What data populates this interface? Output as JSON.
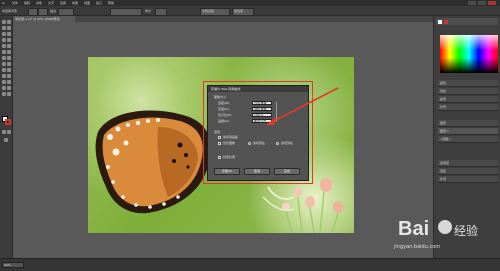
{
  "menubar": {
    "items": [
      "Ai",
      "文件",
      "编辑",
      "对象",
      "文字",
      "选择",
      "效果",
      "视图",
      "窗口",
      "帮助"
    ]
  },
  "optionbar": {
    "selection_label": "未选择对象",
    "stroke_label": "描边",
    "style_label": "样式",
    "doc_setup_label": "文档设置",
    "prefs_label": "首选项"
  },
  "document": {
    "tab_label": "未标题-1.ai* @ 50% (RGB/预览)"
  },
  "dialog": {
    "title": "存储为 Web 所用格式",
    "section_size": "图像大小",
    "rows": [
      {
        "label": "宽度(W):",
        "value": "720 像素"
      },
      {
        "label": "高度(H):",
        "value": "480 像素"
      },
      {
        "label": "百分比(P):",
        "value": "100 %"
      },
      {
        "label": "品质(Q):",
        "value": "两次立方"
      }
    ],
    "section_options": "选项",
    "checkbox_1": "剪切到画板",
    "checkbox_2": "优化图像",
    "radio_a": "剪切到左",
    "radio_b": "剪切到右",
    "checkbox_3": "约束比例",
    "buttons": [
      "存储(S)",
      "取消",
      "完成"
    ]
  },
  "right_panel": {
    "rows": [
      "颜色",
      "色板",
      "画笔",
      "符号",
      "图层",
      "图层 1",
      "<图像>",
      "透明度",
      "渐变",
      "外观"
    ]
  },
  "status": {
    "zoom": "50%"
  },
  "watermark": {
    "text": "Bai",
    "brand": "经验",
    "url": "jingyan.baidu.com"
  },
  "colors": {
    "highlight": "#e03a2a",
    "arrow": "#e03a2a"
  }
}
